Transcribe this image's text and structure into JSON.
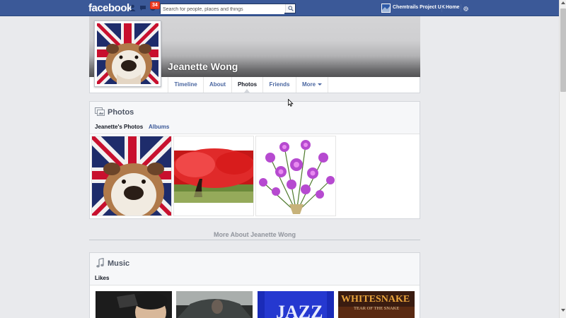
{
  "topbar": {
    "logo": "facebook",
    "notification_count": "34",
    "search_placeholder": "Search for people, places and things",
    "user_name": "Chemtrails Project UK",
    "home_label": "Home",
    "bg_color": "#3b5998"
  },
  "profile": {
    "name": "Jeanette Wong",
    "tabs": [
      {
        "label": "Timeline"
      },
      {
        "label": "About"
      },
      {
        "label": "Photos"
      },
      {
        "label": "Friends"
      },
      {
        "label": "More"
      }
    ],
    "active_tab": "Photos"
  },
  "photos": {
    "title": "Photos",
    "subtabs": [
      {
        "label": "Jeanette's Photos"
      },
      {
        "label": "Albums"
      }
    ],
    "items": [
      {
        "icon": "bulldog-union-jack-photo"
      },
      {
        "icon": "red-tree-photo"
      },
      {
        "icon": "purple-flowers-photo"
      }
    ]
  },
  "more_about": "More About Jeanette Wong",
  "music": {
    "title": "Music",
    "likes_label": "Likes",
    "albums": [
      {
        "icon": "album-cover-1"
      },
      {
        "icon": "album-cover-2"
      },
      {
        "icon": "album-cover-jazz",
        "text": "JAZZ"
      },
      {
        "icon": "album-cover-whitesnake",
        "text": "WHITESNAKE",
        "subtitle": "TEAR OF THE SNAKE"
      }
    ]
  }
}
